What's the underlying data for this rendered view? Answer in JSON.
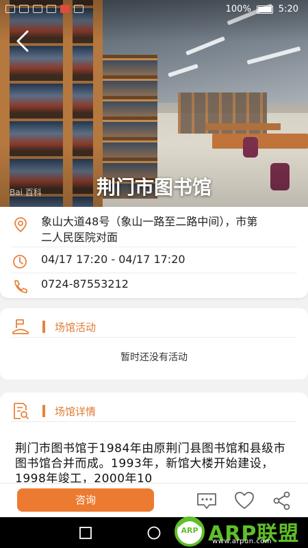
{
  "status_bar": {
    "battery_percent": "100%",
    "time": "5:20"
  },
  "hero": {
    "title": "荆门市图书馆",
    "watermark": "Bai 百科"
  },
  "info": {
    "address": "象山大道48号（象山一路至二路中间），市第二人民医院对面",
    "hours": "04/17 17:20 - 04/17 17:20",
    "phone": "0724-87553212"
  },
  "activities": {
    "title": "场馆活动",
    "empty_text": "暂时还没有活动"
  },
  "details": {
    "title": "场馆详情",
    "description": "荆门市图书馆于1984年由原荆门县图书馆和县级市图书馆合并而成。1993年，新馆大楼开始建设，1998年竣工，2000年10"
  },
  "bottom_bar": {
    "consult_label": "咨询"
  },
  "watermark_logo": {
    "brand": "ARP联盟",
    "badge": "ARP",
    "url": "www.arpun.com"
  },
  "colors": {
    "accent": "#ec7b31",
    "accent_text": "#e07a34"
  }
}
